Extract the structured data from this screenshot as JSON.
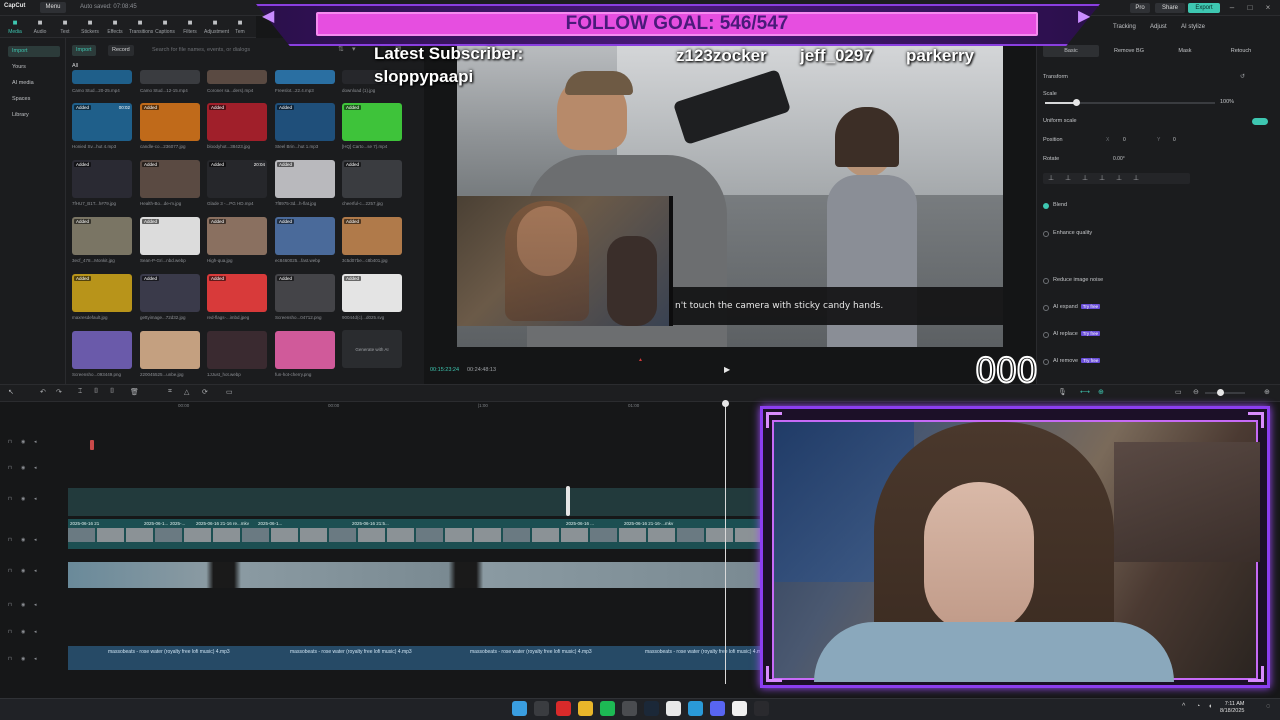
{
  "app": {
    "logo": "CapCut",
    "menu_label": "Menu",
    "autosave": "Auto saved: 07:08:45",
    "pro_label": "Pro",
    "share_label": "Share",
    "export_label": "Export"
  },
  "media_toolbar": [
    {
      "label": "Media",
      "icon": "media-icon",
      "active": true
    },
    {
      "label": "Audio",
      "icon": "audio-icon"
    },
    {
      "label": "Text",
      "icon": "text-icon"
    },
    {
      "label": "Stickers",
      "icon": "stickers-icon"
    },
    {
      "label": "Effects",
      "icon": "effects-icon"
    },
    {
      "label": "Transitions",
      "icon": "transitions-icon"
    },
    {
      "label": "Captions",
      "icon": "captions-icon"
    },
    {
      "label": "Filters",
      "icon": "filters-icon"
    },
    {
      "label": "Adjustment",
      "icon": "adjustment-icon"
    },
    {
      "label": "Tem",
      "icon": "templates-icon"
    }
  ],
  "left_nav": [
    "Import",
    "Yours",
    "AI media",
    "Spaces",
    "Library"
  ],
  "media_panel": {
    "import_tab": "Import",
    "record_tab": "Record",
    "search_placeholder": "Search for file names, events, or dialogs",
    "all_label": "All",
    "row0_names": [
      "Camo Stud...20-25.mp4",
      "Camo Stud...12-15.mp4",
      "Coroner sa...ders).mp4",
      "Freeslot...22.4.mp3",
      "download (1).jpg"
    ],
    "items": [
      {
        "name": "Honied Sv...hut 4.mp3",
        "tag": "Added",
        "dur": "00:02",
        "color": "#1f5f8a"
      },
      {
        "name": "candle-co...236077.jpg",
        "tag": "Added",
        "dur": "",
        "color": "#c06a1a"
      },
      {
        "name": "bloodyhot...38423.jpg",
        "tag": "Added",
        "dur": "",
        "color": "#a01f2a"
      },
      {
        "name": "Steel Brin...hut 1.mp3",
        "tag": "Added",
        "dur": "",
        "color": "#1f4f7a"
      },
      {
        "name": "[HQ] Carto...se 7).mp4",
        "tag": "Added",
        "dur": "",
        "color": "#3ec33a"
      },
      {
        "name": "7fHU7_B1T...h#79.jpg",
        "tag": "Added",
        "dur": "",
        "color": "#2a2a33"
      },
      {
        "name": "Health-Bo...de-m.jpg",
        "tag": "Added",
        "dur": "",
        "color": "#5a4a42"
      },
      {
        "name": "Glade 3 -...PG HD.mp4",
        "tag": "Added",
        "dur": "20:04",
        "color": "#26272b"
      },
      {
        "name": "7f8975-3d...h-flat.jpg",
        "tag": "Added",
        "dur": "",
        "color": "#b9b9bd"
      },
      {
        "name": "cheerful-c...2257.jpg",
        "tag": "Added",
        "dur": "",
        "color": "#3a3c40"
      },
      {
        "name": "3ecf_478...Monkit.jpg",
        "tag": "Added",
        "dur": "",
        "color": "#7a7564"
      },
      {
        "name": "Sean-P-Gri...nbd.webp",
        "tag": "Added",
        "dur": "",
        "color": "#dcdcdc"
      },
      {
        "name": "High-qua.jpg",
        "tag": "Added",
        "dur": "",
        "color": "#8a7060"
      },
      {
        "name": "ec8460025...fast.webp",
        "tag": "Added",
        "dur": "",
        "color": "#4a6a9a"
      },
      {
        "name": "3c5d07be...c8b401.jpg",
        "tag": "Added",
        "dur": "",
        "color": "#b07a4a"
      },
      {
        "name": "maxresdefault.jpg",
        "tag": "Added",
        "dur": "",
        "color": "#b8941a"
      },
      {
        "name": "gettyimage...72d32.jpg",
        "tag": "Added",
        "dur": "",
        "color": "#3a3a4a"
      },
      {
        "name": "red-flags-...imbd.jpeg",
        "tag": "Added",
        "dur": "",
        "color": "#d83a3a"
      },
      {
        "name": "Screensho...04712.png",
        "tag": "Added",
        "dur": "",
        "color": "#444448"
      },
      {
        "name": "90044d(c)...d025.svg",
        "tag": "Added",
        "dur": "",
        "color": "#e4e4e4"
      },
      {
        "name": "Screensho...093449.png",
        "tag": "",
        "dur": "",
        "color": "#6a5aaa"
      },
      {
        "name": "220045525...unbe.jpg",
        "tag": "",
        "dur": "",
        "color": "#c4a080"
      },
      {
        "name": "1JJust_hot.webp",
        "tag": "",
        "dur": "",
        "color": "#3a2a30"
      },
      {
        "name": "fun-hot-cherry.png",
        "tag": "",
        "dur": "",
        "color": "#d05a9a"
      }
    ],
    "generate_label": "Generate with AI"
  },
  "player": {
    "subtitle": "n't touch the camera with sticky candy hands.",
    "timecode_current": "00:15:23:24",
    "timecode_total": "00:24:48:13"
  },
  "inspector": {
    "tabs": [
      "Tracking",
      "Adjust",
      "AI stylize"
    ],
    "subtabs": [
      "Basic",
      "Remove BG",
      "Mask",
      "Retouch"
    ],
    "transform": "Transform",
    "scale_label": "Scale",
    "scale_value": "100%",
    "scale_fraction": 0.18,
    "uniform_scale": "Uniform scale",
    "position_label": "Position",
    "pos_x_label": "X",
    "pos_x": "0",
    "pos_y_label": "Y",
    "pos_y": "0",
    "rotate_label": "Rotate",
    "rotate_value": "0.00°",
    "blend": "Blend",
    "enhance": "Enhance quality",
    "reduce_noise": "Reduce image noise",
    "ai_expand": "AI expand",
    "ai_replace": "AI replace",
    "ai_remove": "AI remove",
    "try_free": "Try free"
  },
  "timeline": {
    "ruler": [
      "00:00",
      "00:00",
      "|1:00",
      "01:00"
    ],
    "clip_labels": [
      "2025-06-16 21",
      "2025-06-1...",
      "2025-...",
      "2025-06-16 21-16 re...mkv",
      "2025-06-1...",
      "2025-06-16 21:5...",
      "2025-06-16 ...",
      "2025-06-16 21-16-...mkv"
    ],
    "audio_label": "massobeats - rose water (royalty free lofi music) 4.mp3"
  },
  "overlay": {
    "goal": "FOLLOW GOAL: 546/547",
    "latest_sub_label": "Latest Subscriber:",
    "latest_sub_name": "sloppypaapi",
    "names": [
      "z123zocker",
      "jeff_0297",
      "parkerry"
    ],
    "counter": "000"
  },
  "taskbar": {
    "time": "7:11 AM",
    "date": "8/18/2025",
    "apps": [
      {
        "name": "windows-start-icon",
        "color": "#3a9ee0"
      },
      {
        "name": "search-icon",
        "color": "#3a3c40"
      },
      {
        "name": "opera-icon",
        "color": "#d92a2a"
      },
      {
        "name": "file-explorer-icon",
        "color": "#e8b62a"
      },
      {
        "name": "spotify-icon",
        "color": "#1db954"
      },
      {
        "name": "calculator-icon",
        "color": "#4a4c50"
      },
      {
        "name": "steam-icon",
        "color": "#1b2838"
      },
      {
        "name": "chrome-icon",
        "color": "#e8e8e8"
      },
      {
        "name": "edge-icon",
        "color": "#2a9ad8"
      },
      {
        "name": "discord-icon",
        "color": "#5865f2"
      },
      {
        "name": "capcut-taskbar-icon",
        "color": "#f0f0f0"
      },
      {
        "name": "obs-icon",
        "color": "#2a2a2e"
      }
    ]
  },
  "colors": {
    "accent": "#3ec7b1",
    "overlay_purple": "#8c3ef0",
    "goal_pink": "#e64ee0"
  }
}
